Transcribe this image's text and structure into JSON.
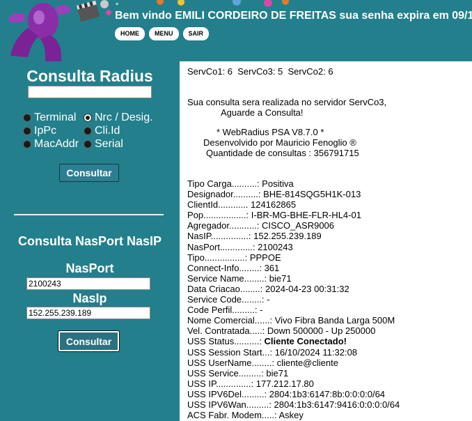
{
  "header": {
    "welcome": "Bem vindo EMILI CORDEIRO DE FREITAS sua senha expira em 09/1",
    "star": "*",
    "nav": [
      "HOME",
      "MENU",
      "SAIR"
    ]
  },
  "sidebar": {
    "radius_title": "Consulta Radius",
    "radius_input_value": "",
    "radios": [
      {
        "label": "Terminal",
        "checked": false
      },
      {
        "label": "Nrc / Desig.",
        "checked": true
      },
      {
        "label": "IpPc",
        "checked": false
      },
      {
        "label": "Cli.Id",
        "checked": false
      },
      {
        "label": "MacAddr",
        "checked": false
      },
      {
        "label": "Serial",
        "checked": false
      }
    ],
    "consultar_label": "Consultar",
    "nasport_title": "Consulta NasPort NasIP",
    "nasport_label": "NasPort",
    "nasport_value": "2100243",
    "nasip_label": "NasIp",
    "nasip_value": "152.255.239.189",
    "consultar2_label": "Consultar"
  },
  "main": {
    "servers_line": "ServCo1: 6  ServCo3: 5  ServCo2: 6",
    "notice_1": "Sua consulta sera realizada no servidor ServCo3,",
    "notice_2": "Aguarde a Consulta!",
    "version": "* WebRadius PSA V8.7.0 *",
    "developer": "Desenvolvido por Mauricio Fenoglio ®",
    "query_count": "Quantidade de consultas : 356791715",
    "results": [
      {
        "label": "Tipo Carga..........: ",
        "value": "Positiva",
        "bold": false
      },
      {
        "label": "Designador..........: ",
        "value": "BHE-814SQG5H1K-013",
        "bold": false
      },
      {
        "label": "ClientId............ ",
        "value": "124162865",
        "bold": false
      },
      {
        "label": "Pop.................: ",
        "value": "I-BR-MG-BHE-FLR-HL4-01",
        "bold": false
      },
      {
        "label": "Agregador...........: ",
        "value": "CISCO_ASR9006",
        "bold": false
      },
      {
        "label": "NasIP...............: ",
        "value": "152.255.239.189",
        "bold": false
      },
      {
        "label": "NasPort.............: ",
        "value": "2100243",
        "bold": false
      },
      {
        "label": "Tipo................: ",
        "value": "PPPOE",
        "bold": false
      },
      {
        "label": "Connect-Info........: ",
        "value": "361",
        "bold": false
      },
      {
        "label": "Service Name........: ",
        "value": "bie71",
        "bold": false
      },
      {
        "label": "Data Criacao........: ",
        "value": "2024-04-23 00:31:32",
        "bold": false
      },
      {
        "label": "Service Code........: ",
        "value": "-",
        "bold": false
      },
      {
        "label": "Code Perfil.........: ",
        "value": "-",
        "bold": false
      },
      {
        "label": "Nome Comercial......: ",
        "value": "Vivo Fibra Banda Larga 500M",
        "bold": false
      },
      {
        "label": "Vel. Contratada.....: ",
        "value": "Down 500000 - Up 250000",
        "bold": false
      },
      {
        "label": "USS Status..........: ",
        "value": "Cliente Conectado!",
        "bold": true
      },
      {
        "label": "USS Session Start...: ",
        "value": "16/10/2024 11:32:08",
        "bold": false
      },
      {
        "label": "USS UserName........: ",
        "value": "cliente@cliente",
        "bold": false
      },
      {
        "label": "USS Service.........: ",
        "value": "bie71",
        "bold": false
      },
      {
        "label": "USS IP..............: ",
        "value": "177.212.17.80",
        "bold": false
      },
      {
        "label": "USS IPV6Del.........: ",
        "value": "2804:1b3:6147:8b:0:0:0:0/64",
        "bold": false
      },
      {
        "label": "USS IPV6Wan.........: ",
        "value": "2804:1b3:6147:9416:0:0:0:0/64",
        "bold": false
      },
      {
        "label": "ACS Fabr. Modem.....: ",
        "value": "Askey",
        "bold": false
      }
    ]
  },
  "colors": {
    "background": "#237f8c",
    "panel": "#ffffff",
    "logo_purple": "#8a2ea8"
  }
}
